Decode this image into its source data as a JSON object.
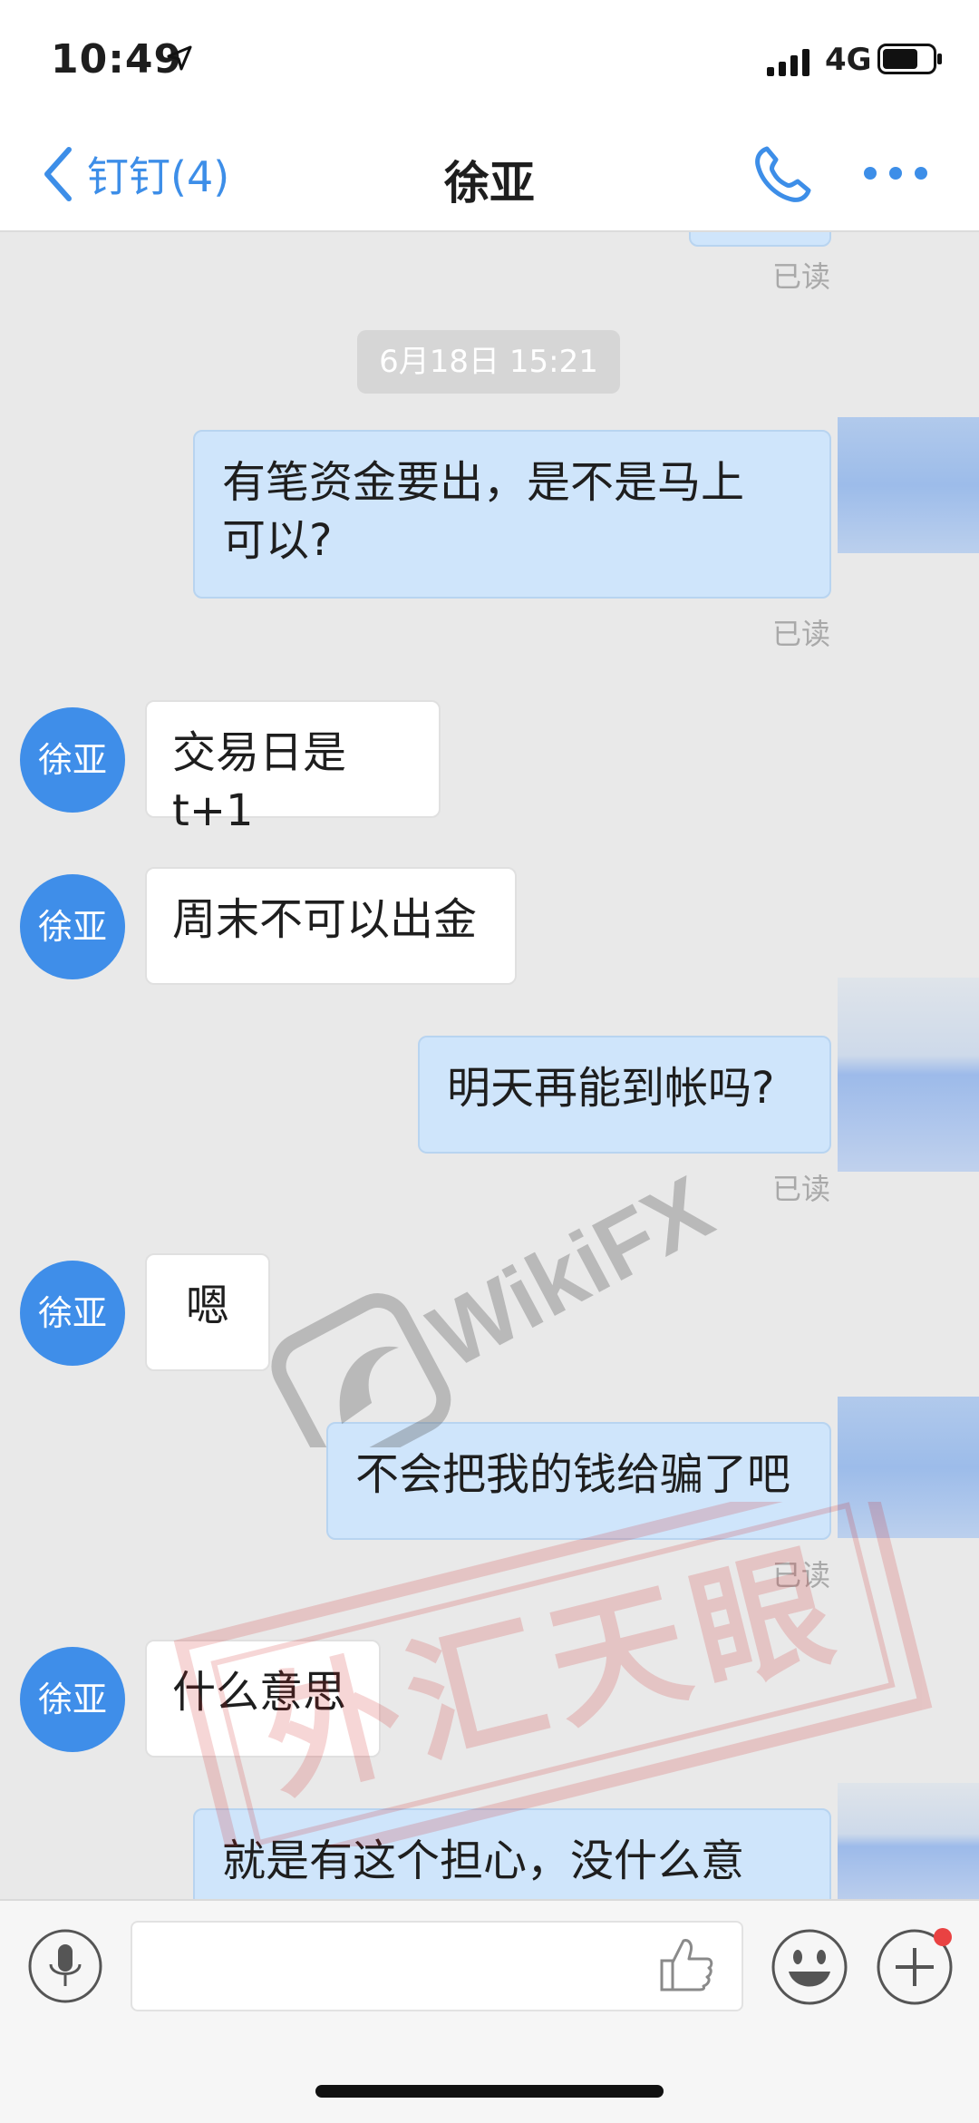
{
  "status_bar": {
    "time": "10:49",
    "network": "4G"
  },
  "nav": {
    "back_label": "钉钉(4)",
    "title": "徐亚"
  },
  "chat": {
    "read_label": "已读",
    "timestamp": "6月18日 15:21",
    "avatar_label": "徐亚",
    "messages": [
      {
        "direction": "out",
        "text": "有笔资金要出，是不是马上\n可以?",
        "read": "已读"
      },
      {
        "direction": "in",
        "text": "交易日是t+1"
      },
      {
        "direction": "in",
        "text": "周末不可以出金"
      },
      {
        "direction": "out",
        "text": "明天再能到帐吗?",
        "read": "已读"
      },
      {
        "direction": "in",
        "text": "嗯"
      },
      {
        "direction": "out",
        "text": "不会把我的钱给骗了吧",
        "read": "已读"
      },
      {
        "direction": "in",
        "text": "什么意思"
      },
      {
        "direction": "out",
        "text": "就是有这个担心，没什么意"
      }
    ]
  },
  "watermark": {
    "logo_text": "WikiFX",
    "stamp_text": "外汇天眼"
  },
  "input_bar": {
    "text_value": ""
  },
  "colors": {
    "accent": "#3d8ee8",
    "outgoing_bubble": "#cfe5fb",
    "incoming_bubble": "#ffffff",
    "avatar": "#3f8ee9",
    "chat_bg": "#e9e9e9",
    "notification_dot": "#e94242"
  }
}
